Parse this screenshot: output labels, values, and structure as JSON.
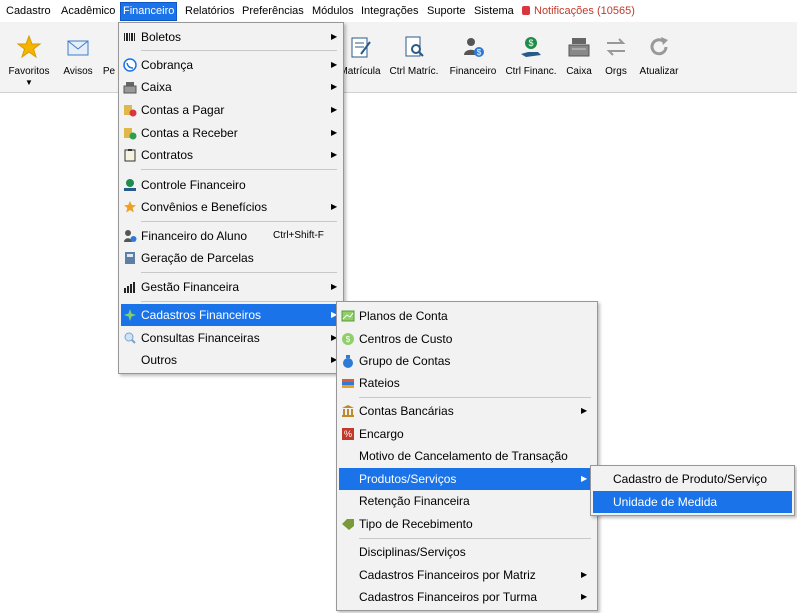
{
  "menubar": {
    "items": [
      "Cadastro",
      "Acadêmico",
      "Financeiro",
      "Relatórios",
      "Preferências",
      "Módulos",
      "Integrações",
      "Suporte",
      "Sistema"
    ],
    "notifications": "Notificações (10565)"
  },
  "toolbar": {
    "favoritos": "Favoritos",
    "avisos": "Avisos",
    "pe": "Pe",
    "matricula": "Matrícula",
    "ctrl_matric": "Ctrl Matríc.",
    "financeiro": "Financeiro",
    "ctrl_financ": "Ctrl Financ.",
    "caixa": "Caixa",
    "orgs": "Orgs",
    "atualizar": "Atualizar"
  },
  "financeiro_menu": {
    "boletos": "Boletos",
    "cobranca": "Cobrança",
    "caixa": "Caixa",
    "contas_pagar": "Contas a Pagar",
    "contas_receber": "Contas a Receber",
    "contratos": "Contratos",
    "controle_financeiro": "Controle Financeiro",
    "convenios": "Convênios e Benefícios",
    "financeiro_aluno": "Financeiro do Aluno",
    "financeiro_aluno_shortcut": "Ctrl+Shift-F",
    "geracao_parcelas": "Geração de Parcelas",
    "gestao_financeira": "Gestão Financeira",
    "cadastros_financeiros": "Cadastros Financeiros",
    "consultas_financeiras": "Consultas Financeiras",
    "outros": "Outros"
  },
  "cadastros_menu": {
    "planos_conta": "Planos de Conta",
    "centros_custo": "Centros de Custo",
    "grupo_contas": "Grupo de Contas",
    "rateios": "Rateios",
    "contas_bancarias": "Contas Bancárias",
    "encargo": "Encargo",
    "motivo_cancelamento": "Motivo de Cancelamento de Transação",
    "produtos_servicos": "Produtos/Serviços",
    "retencao": "Retenção Financeira",
    "tipo_recebimento": "Tipo de Recebimento",
    "disciplinas_servicos": "Disciplinas/Serviços",
    "por_matriz": "Cadastros Financeiros por Matriz",
    "por_turma": "Cadastros Financeiros por Turma"
  },
  "produtos_menu": {
    "cadastro_produto": "Cadastro de Produto/Serviço",
    "unidade_medida": "Unidade de Medida"
  },
  "colors": {
    "highlight": "#1a73e8",
    "notification": "#c0392b"
  }
}
